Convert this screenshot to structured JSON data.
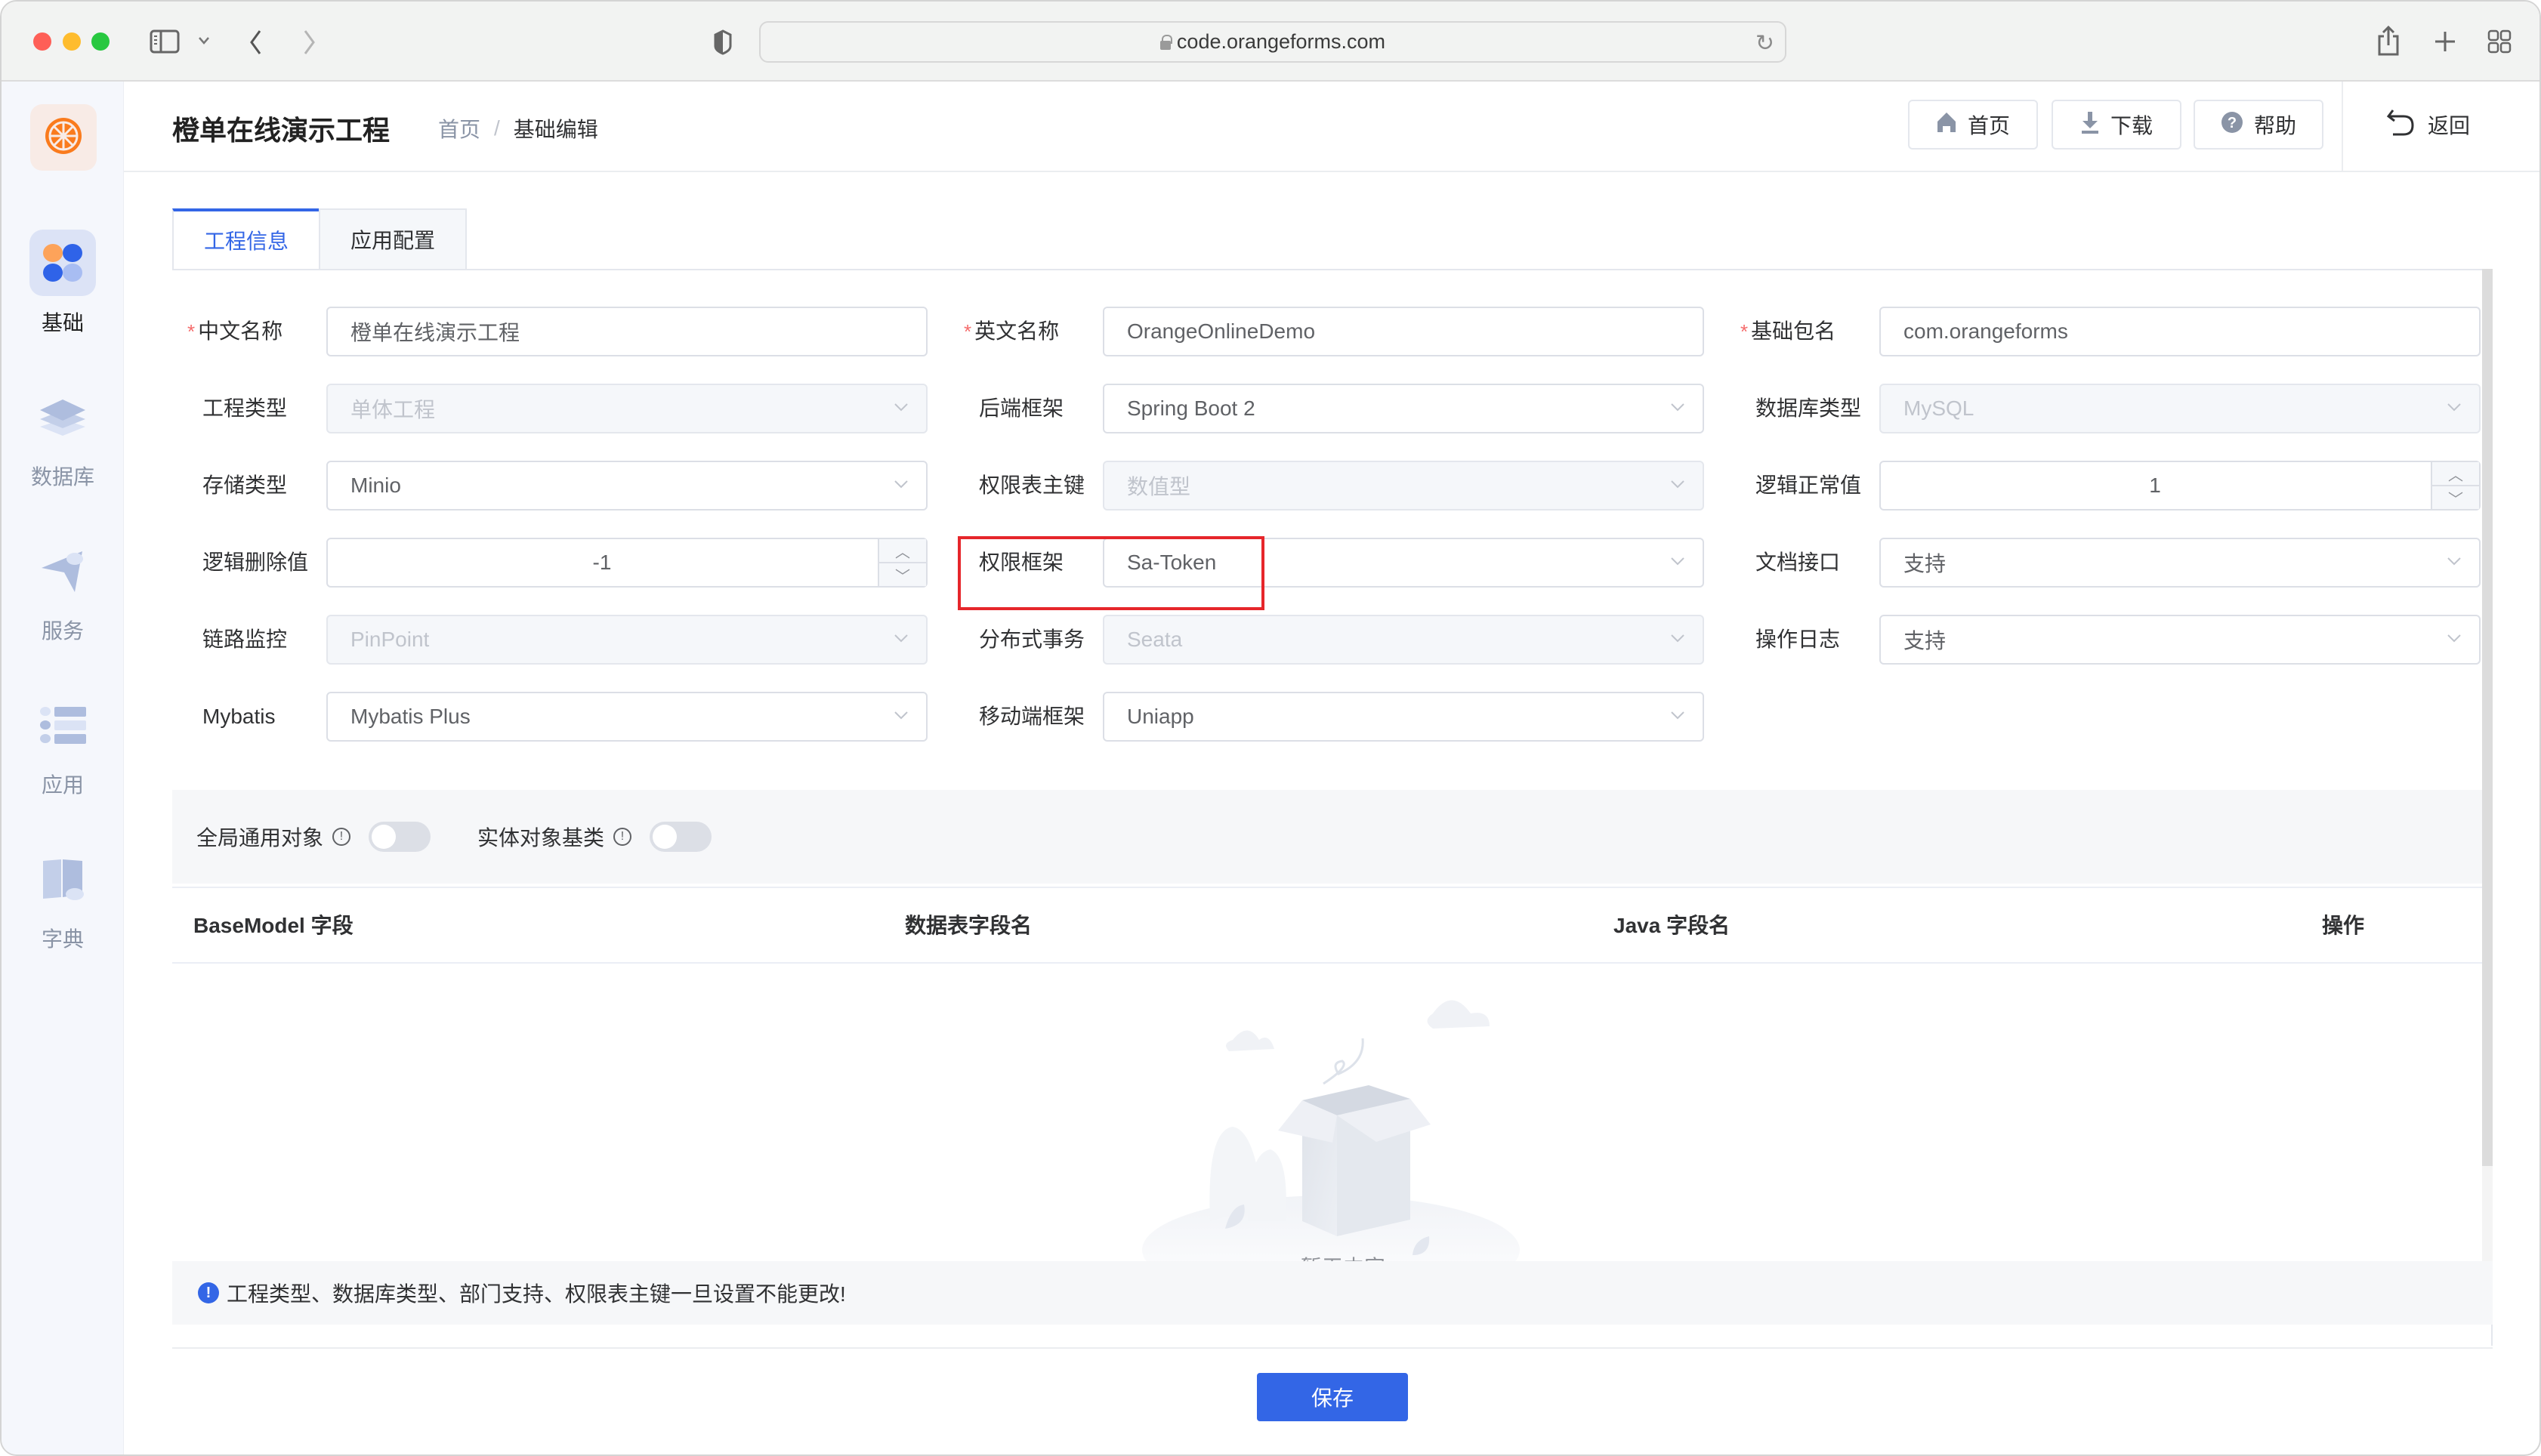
{
  "browser": {
    "url": "code.orangeforms.com",
    "icons": [
      "sidebar-toggle-icon",
      "chevron-down-icon",
      "back-icon",
      "forward-icon",
      "shield-icon",
      "lock-icon",
      "reload-icon",
      "share-icon",
      "new-tab-icon",
      "tab-overview-icon"
    ]
  },
  "sidebar": {
    "logo_icon": "orange-slice-icon",
    "items": [
      {
        "label": "基础",
        "icon": "basic-grid-icon",
        "active": true
      },
      {
        "label": "数据库",
        "icon": "database-layers-icon",
        "active": false
      },
      {
        "label": "服务",
        "icon": "service-send-icon",
        "active": false
      },
      {
        "label": "应用",
        "icon": "app-list-icon",
        "active": false
      },
      {
        "label": "字典",
        "icon": "dictionary-book-icon",
        "active": false
      }
    ]
  },
  "header": {
    "title": "橙单在线演示工程",
    "breadcrumb": {
      "home": "首页",
      "separator": "/",
      "current": "基础编辑"
    },
    "buttons": [
      {
        "label": "首页",
        "icon": "home-icon"
      },
      {
        "label": "下载",
        "icon": "download-icon"
      },
      {
        "label": "帮助",
        "icon": "help-icon"
      }
    ],
    "back_label": "返回"
  },
  "tabs": [
    {
      "label": "工程信息",
      "active": true
    },
    {
      "label": "应用配置",
      "active": false
    }
  ],
  "form": {
    "fields": {
      "cn_name": {
        "label": "中文名称",
        "required": true,
        "value": "橙单在线演示工程",
        "type": "text"
      },
      "en_name": {
        "label": "英文名称",
        "required": true,
        "value": "OrangeOnlineDemo",
        "type": "text"
      },
      "base_package": {
        "label": "基础包名",
        "required": true,
        "value": "com.orangeforms",
        "type": "text"
      },
      "project_type": {
        "label": "工程类型",
        "value": "单体工程",
        "type": "select",
        "disabled": true
      },
      "backend_framework": {
        "label": "后端框架",
        "value": "Spring Boot 2",
        "type": "select"
      },
      "db_type": {
        "label": "数据库类型",
        "value": "MySQL",
        "type": "select",
        "disabled": true
      },
      "storage_type": {
        "label": "存储类型",
        "value": "Minio",
        "type": "select"
      },
      "perm_table_pk": {
        "label": "权限表主键",
        "value": "数值型",
        "type": "select",
        "disabled": true
      },
      "logic_normal_value": {
        "label": "逻辑正常值",
        "value": "1",
        "type": "number"
      },
      "logic_delete_value": {
        "label": "逻辑删除值",
        "value": "-1",
        "type": "number"
      },
      "perm_framework": {
        "label": "权限框架",
        "value": "Sa-Token",
        "type": "select",
        "highlighted": true
      },
      "doc_api": {
        "label": "文档接口",
        "value": "支持",
        "type": "select"
      },
      "trace_monitor": {
        "label": "链路监控",
        "value": "PinPoint",
        "type": "select",
        "disabled": true
      },
      "distributed_tx": {
        "label": "分布式事务",
        "value": "Seata",
        "type": "select",
        "disabled": true
      },
      "operation_log": {
        "label": "操作日志",
        "value": "支持",
        "type": "select"
      },
      "mybatis": {
        "label": "Mybatis",
        "value": "Mybatis Plus",
        "type": "select"
      },
      "mobile_framework": {
        "label": "移动端框架",
        "value": "Uniapp",
        "type": "select"
      }
    }
  },
  "switches": [
    {
      "label": "全局通用对象",
      "on": false
    },
    {
      "label": "实体对象基类",
      "on": false
    }
  ],
  "table": {
    "columns": [
      "BaseModel 字段",
      "数据表字段名",
      "Java 字段名",
      "操作"
    ],
    "rows": [],
    "empty_text": "暂无内容"
  },
  "notice": "工程类型、数据库类型、部门支持、权限表主键一旦设置不能更改!",
  "save_label": "保存",
  "colors": {
    "primary": "#3366e6",
    "brand_orange": "#fa7b1d",
    "highlight_red": "#e6262b",
    "required_star": "#f56c6c"
  }
}
